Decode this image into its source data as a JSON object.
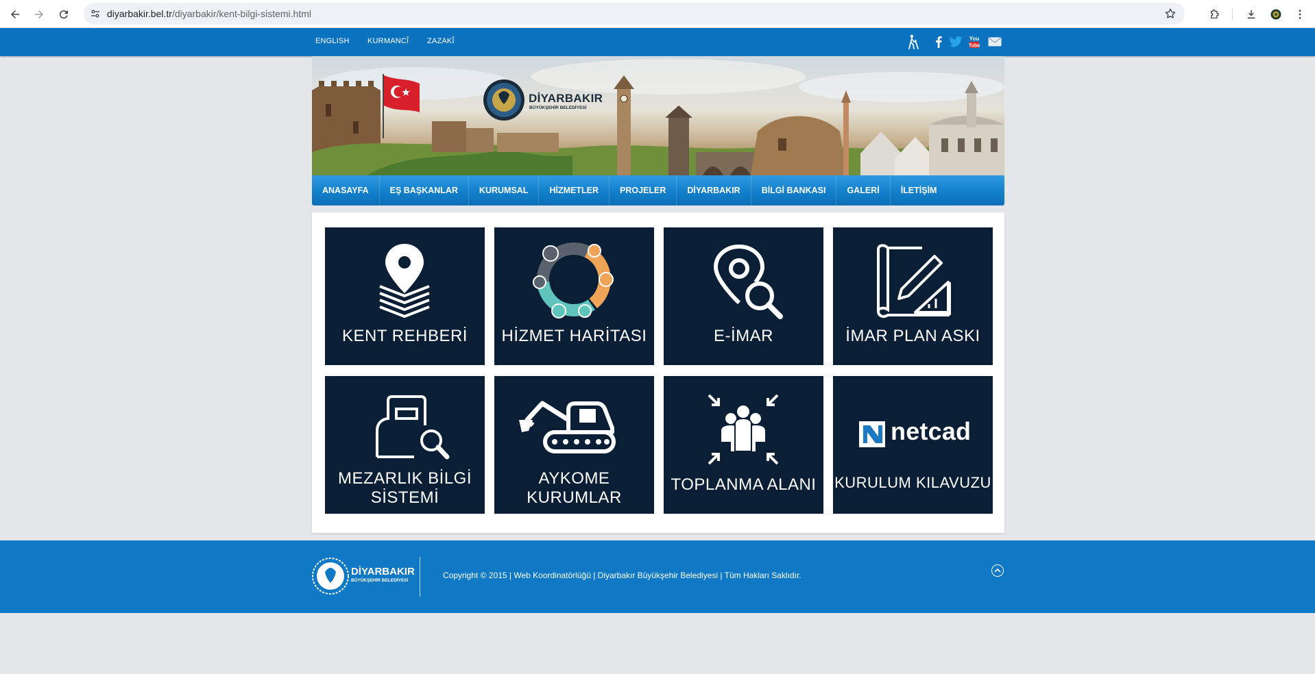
{
  "browser": {
    "url_host": "diyarbakir.bel.tr",
    "url_path": "/diyarbakir/kent-bilgi-sistemi.html"
  },
  "topbar": {
    "languages": [
      "ENGLISH",
      "KURMANCÎ",
      "ZAZAKÎ"
    ]
  },
  "banner": {
    "logo_name": "DİYARBAKIR",
    "logo_sub": "BÜYÜKŞEHİR BELEDİYESİ"
  },
  "nav": {
    "items": [
      "ANASAYFA",
      "EŞ BAŞKANLAR",
      "KURUMSAL",
      "HİZMETLER",
      "PROJELER",
      "DİYARBAKIR",
      "BİLGİ BANKASI",
      "GALERİ",
      "İLETİŞİM"
    ]
  },
  "tiles": [
    {
      "line1": "KENT REHBERİ",
      "line2": ""
    },
    {
      "line1": "HİZMET HARİTASI",
      "line2": ""
    },
    {
      "line1": "E-İMAR",
      "line2": ""
    },
    {
      "line1": "İMAR PLAN ASKI",
      "line2": ""
    },
    {
      "line1": "MEZARLIK BİLGİ",
      "line2": "SİSTEMİ"
    },
    {
      "line1": "AYKOME",
      "line2": "KURUMLAR"
    },
    {
      "line1": "TOPLANMA ALANI",
      "line2": ""
    },
    {
      "line1": "KURULUM KILAVUZU",
      "line2": "",
      "brand": "netcad"
    }
  ],
  "footer": {
    "logo_name": "DİYARBAKIR",
    "logo_sub": "BÜYÜKŞEHİR BELEDİYESİ",
    "copyright": "Copyright © 2015 | Web Koordinatörlüğü | Diyarbakır Büyükşehir Belediyesi | Tüm Hakları Saklıdır."
  },
  "colors": {
    "topbar": "#0a72be",
    "nav": "#127fcb",
    "tile": "#0a1e35",
    "footer": "#0f79c6",
    "accent_orange": "#f0a458",
    "accent_teal": "#5fc4bc"
  }
}
